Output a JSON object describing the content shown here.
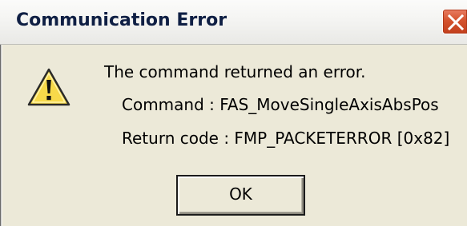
{
  "window": {
    "title": "Communication Error"
  },
  "titlebar": {
    "close_icon": "close-icon"
  },
  "dialog": {
    "icon": "warning-icon",
    "message_line1": "The command returned an error.",
    "message_line2": "Command : FAS_MoveSingleAxisAbsPos",
    "message_line3": "Return code : FMP_PACKETERROR [0x82]",
    "ok_label": "OK"
  },
  "colors": {
    "title_text": "#0f1f44",
    "dialog_background": "#ece9d8",
    "close_button": "#d4532e",
    "warning_fill": "#f7d94a"
  }
}
